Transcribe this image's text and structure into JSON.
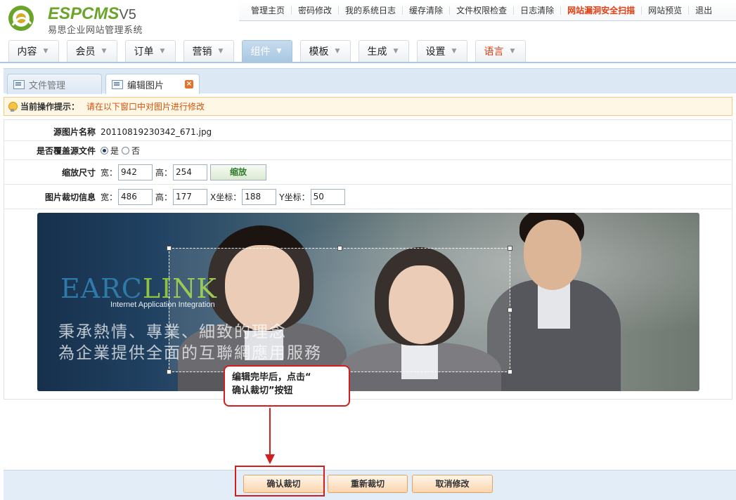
{
  "app": {
    "logo_text": "ESPCMS",
    "logo_version": "V5",
    "logo_subtitle": "易思企业网站管理系统"
  },
  "topnav": {
    "items": [
      {
        "label": "管理主页"
      },
      {
        "label": "密码修改"
      },
      {
        "label": "我的系统日志"
      },
      {
        "label": "缓存清除"
      },
      {
        "label": "文件权限检查"
      },
      {
        "label": "日志清除"
      },
      {
        "label": "网站漏洞安全扫描"
      },
      {
        "label": "网站预览"
      },
      {
        "label": "退出"
      }
    ]
  },
  "mainnav": {
    "items": [
      {
        "label": "内容"
      },
      {
        "label": "会员"
      },
      {
        "label": "订单"
      },
      {
        "label": "营销"
      },
      {
        "label": "组件"
      },
      {
        "label": "模板"
      },
      {
        "label": "生成"
      },
      {
        "label": "设置"
      },
      {
        "label": "语言"
      }
    ],
    "active": "组件"
  },
  "subtabs": {
    "items": [
      {
        "label": "文件管理"
      },
      {
        "label": "编辑图片"
      }
    ],
    "active": "编辑图片"
  },
  "tip": {
    "label": "当前操作提示：",
    "text": "请在以下窗口中对图片进行修改"
  },
  "form": {
    "source_name_label": "源图片名称",
    "source_name_value": "20110819230342_671.jpg",
    "overwrite_label": "是否覆盖源文件",
    "overwrite_yes": "是",
    "overwrite_no": "否",
    "resize_label": "缩放尺寸",
    "crop_label": "图片裁切信息",
    "width_label": "宽：",
    "height_label": "高：",
    "x_label": "X坐标：",
    "y_label": "Y坐标：",
    "resize_width": "942",
    "resize_height": "254",
    "resize_button": "缩放",
    "crop_width": "486",
    "crop_height": "177",
    "crop_x": "188",
    "crop_y": "50"
  },
  "image": {
    "brand_part1": "EARC",
    "brand_part2": "LINK",
    "tagline": "Internet Application Integration",
    "line1": "秉承熱情、專業、細致的理念",
    "line2": "為企業提供全面的互聯網應用服務"
  },
  "callout": {
    "line1": "编辑完毕后，点击“",
    "line2": "确认裁切”按钮"
  },
  "buttons": {
    "confirm": "确认裁切",
    "recrop": "重新裁切",
    "cancel": "取消修改"
  },
  "colors": {
    "accent_red": "#d11e1e",
    "brand_green": "#6aa52a",
    "nav_active": "#a9c7e2",
    "tip_text": "#d0540c"
  }
}
